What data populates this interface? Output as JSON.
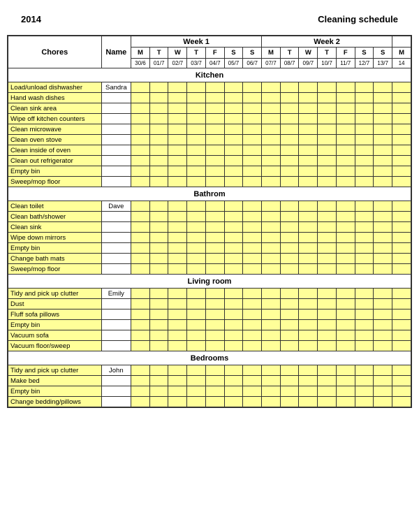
{
  "header": {
    "year": "2014",
    "title": "Cleaning schedule"
  },
  "columns": {
    "chores": "Chores",
    "name": "Name",
    "week1": "Week 1",
    "week2": "Week 2",
    "days": [
      "M",
      "T",
      "W",
      "T",
      "F",
      "S",
      "S",
      "M",
      "T",
      "W",
      "T",
      "F",
      "S",
      "S",
      "M"
    ],
    "dates": [
      "30/6",
      "01/7",
      "02/7",
      "03/7",
      "04/7",
      "05/7",
      "06/7",
      "07/7",
      "08/7",
      "09/7",
      "10/7",
      "11/7",
      "12/7",
      "13/7",
      "14"
    ]
  },
  "sections": [
    {
      "title": "Kitchen",
      "tasks": [
        {
          "label": "Load/unload dishwasher",
          "name": "Sandra"
        },
        {
          "label": "Hand wash dishes",
          "name": ""
        },
        {
          "label": "Clean sink area",
          "name": ""
        },
        {
          "label": "Wipe off kitchen counters",
          "name": ""
        },
        {
          "label": "Clean microwave",
          "name": ""
        },
        {
          "label": "Clean oven stove",
          "name": ""
        },
        {
          "label": "Clean inside of oven",
          "name": ""
        },
        {
          "label": "Clean out refrigerator",
          "name": ""
        },
        {
          "label": "Empty bin",
          "name": ""
        },
        {
          "label": "Sweep/mop floor",
          "name": ""
        }
      ]
    },
    {
      "title": "Bathrom",
      "tasks": [
        {
          "label": "Clean toilet",
          "name": "Dave"
        },
        {
          "label": "Clean bath/shower",
          "name": ""
        },
        {
          "label": "Clean sink",
          "name": ""
        },
        {
          "label": "Wipe down mirrors",
          "name": ""
        },
        {
          "label": "Empty bin",
          "name": ""
        },
        {
          "label": "Change bath mats",
          "name": ""
        },
        {
          "label": "Sweep/mop floor",
          "name": ""
        }
      ]
    },
    {
      "title": "Living room",
      "tasks": [
        {
          "label": "Tidy and pick up clutter",
          "name": "Emily"
        },
        {
          "label": "Dust",
          "name": ""
        },
        {
          "label": "Fluff sofa pillows",
          "name": ""
        },
        {
          "label": "Empty bin",
          "name": ""
        },
        {
          "label": "Vacuum sofa",
          "name": ""
        },
        {
          "label": "Vacuum floor/sweep",
          "name": ""
        }
      ]
    },
    {
      "title": "Bedrooms",
      "tasks": [
        {
          "label": "Tidy and pick up clutter",
          "name": "John"
        },
        {
          "label": "Make bed",
          "name": ""
        },
        {
          "label": "Empty bin",
          "name": ""
        },
        {
          "label": "Change bedding/pillows",
          "name": ""
        }
      ]
    }
  ]
}
